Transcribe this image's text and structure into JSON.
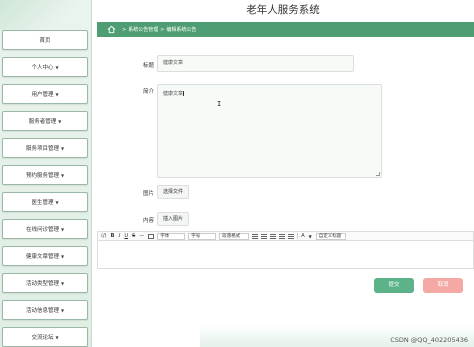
{
  "app": {
    "title": "老年人服务系统"
  },
  "breadcrumb": {
    "items": [
      "系统公告管理",
      "编辑系统公告"
    ],
    "separator": ">"
  },
  "sidebar": {
    "items": [
      {
        "label": "首页",
        "has_caret": false
      },
      {
        "label": "个人中心",
        "has_caret": true
      },
      {
        "label": "用户管理",
        "has_caret": true
      },
      {
        "label": "服务者管理",
        "has_caret": true
      },
      {
        "label": "服务项目管理",
        "has_caret": true
      },
      {
        "label": "预约服务管理",
        "has_caret": true
      },
      {
        "label": "医生管理",
        "has_caret": true
      },
      {
        "label": "在线问诊管理",
        "has_caret": true
      },
      {
        "label": "健康文章管理",
        "has_caret": true
      },
      {
        "label": "活动类型管理",
        "has_caret": true
      },
      {
        "label": "活动信息管理",
        "has_caret": true
      },
      {
        "label": "交流论坛",
        "has_caret": true
      }
    ]
  },
  "form": {
    "title_label": "标题",
    "title_value": "健康文章",
    "intro_label": "简介",
    "intro_value": "健康文章",
    "image_label": "图片",
    "image_button": "选择文件",
    "content_label": "内容",
    "content_button": "插入图片"
  },
  "editor": {
    "bold": "B",
    "italic": "I",
    "underline": "U",
    "strike": "S",
    "font_select": "字体",
    "size_select": "字号",
    "paragraph_select": "段落格式",
    "text_color": "A",
    "custom_select": "自定义标题"
  },
  "actions": {
    "submit": "提交",
    "cancel": "取消"
  },
  "watermark": "CSDN @QQ_402205436",
  "colors": {
    "accent": "#4f9d72",
    "submit": "#5cb38a",
    "cancel": "#f4a9a4"
  }
}
